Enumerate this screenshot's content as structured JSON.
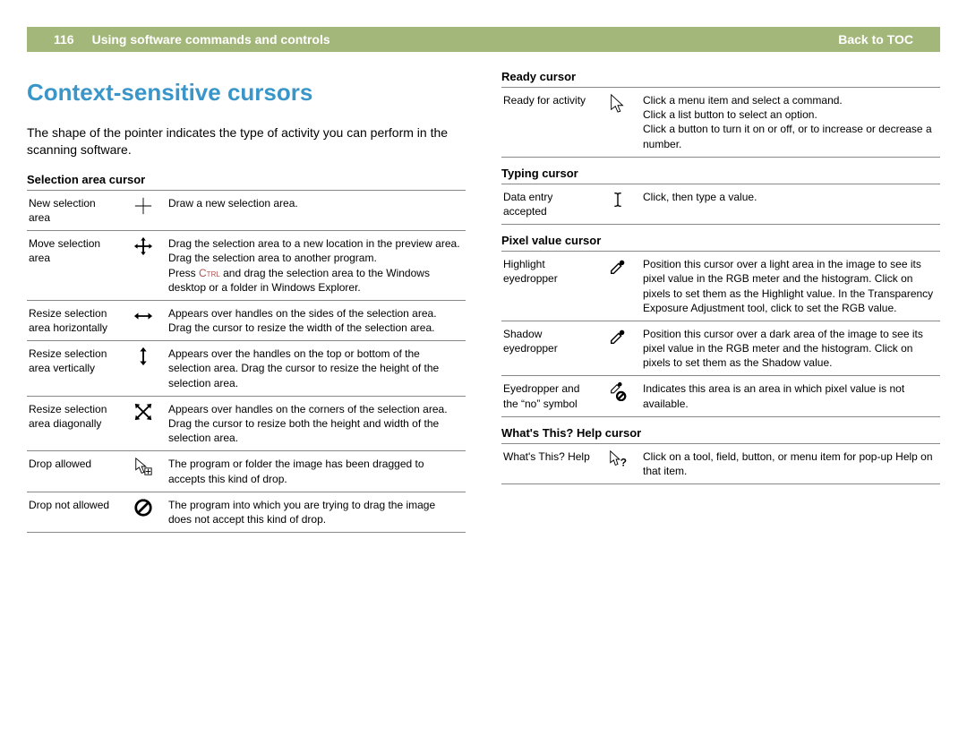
{
  "header": {
    "page_num": "116",
    "crumb": "Using software commands and controls",
    "back": "Back to TOC"
  },
  "title": "Context-sensitive cursors",
  "intro": "The shape of the pointer indicates the type of activity you can perform in the scanning software.",
  "left_sections": [
    {
      "heading": "Selection area cursor",
      "rows": [
        {
          "name": "New selection area",
          "icon": "crosshair-icon",
          "desc": "Draw a new selection area."
        },
        {
          "name": "Move selection area",
          "icon": "move-icon",
          "desc_html": "Drag the selection area to a new location in the preview area.<br>Drag the selection area to another program.<br>Press <span class='ctrl'>Ctrl</span> and drag the selection area to the Windows desktop or a folder in Windows Explorer."
        },
        {
          "name": "Resize selection area horizontally",
          "icon": "resize-h-icon",
          "desc": "Appears over handles on the sides of the selection area. Drag the cursor to resize the width of the selection area."
        },
        {
          "name": "Resize selection area vertically",
          "icon": "resize-v-icon",
          "desc": "Appears over the handles on the top or bottom of the selection area. Drag the cursor to resize the height of the selection area."
        },
        {
          "name": "Resize selection area diagonally",
          "icon": "resize-d-icon",
          "desc": "Appears over handles on the corners of the selection area. Drag the cursor to resize both the height and width of the selection area."
        },
        {
          "name": "Drop allowed",
          "icon": "drop-allowed-icon",
          "desc": "The program or folder the image has been dragged to accepts this kind of drop."
        },
        {
          "name": "Drop not allowed",
          "icon": "drop-not-allowed-icon",
          "desc": "The program into which you are trying to drag the image does not accept this kind of drop."
        }
      ]
    }
  ],
  "right_sections": [
    {
      "heading": "Ready cursor",
      "rows": [
        {
          "name": "Ready for activity",
          "icon": "arrow-icon",
          "desc_html": "Click a menu item and select a command.<br>Click a list button to select an option.<br>Click a button to turn it on or off, or to increase or decrease a number."
        }
      ]
    },
    {
      "heading": "Typing cursor",
      "rows": [
        {
          "name": "Data entry accepted",
          "icon": "ibeam-icon",
          "desc": "Click, then type a value."
        }
      ]
    },
    {
      "heading": "Pixel value cursor",
      "rows": [
        {
          "name": "Highlight eyedropper",
          "icon": "eyedropper-icon",
          "desc": "Position this cursor over a light area in the image to see its pixel value in the RGB meter and the histogram. Click on pixels to set them as the Highlight value. In the Transparency Exposure Adjustment tool, click to set the RGB value."
        },
        {
          "name": "Shadow eyedropper",
          "icon": "eyedropper-icon",
          "desc": "Position this cursor over a dark area of the image to see its pixel value in the RGB meter and the histogram. Click on pixels to set them as the Shadow value."
        },
        {
          "name": "Eyedropper and the “no” symbol",
          "icon": "eyedropper-no-icon",
          "desc": "Indicates this area is an area in which pixel value is not available."
        }
      ]
    },
    {
      "heading": "What's This? Help cursor",
      "rows": [
        {
          "name": "What's This? Help",
          "icon": "arrow-help-icon",
          "desc": "Click on a tool, field, button, or menu item for pop-up Help on that item."
        }
      ]
    }
  ]
}
